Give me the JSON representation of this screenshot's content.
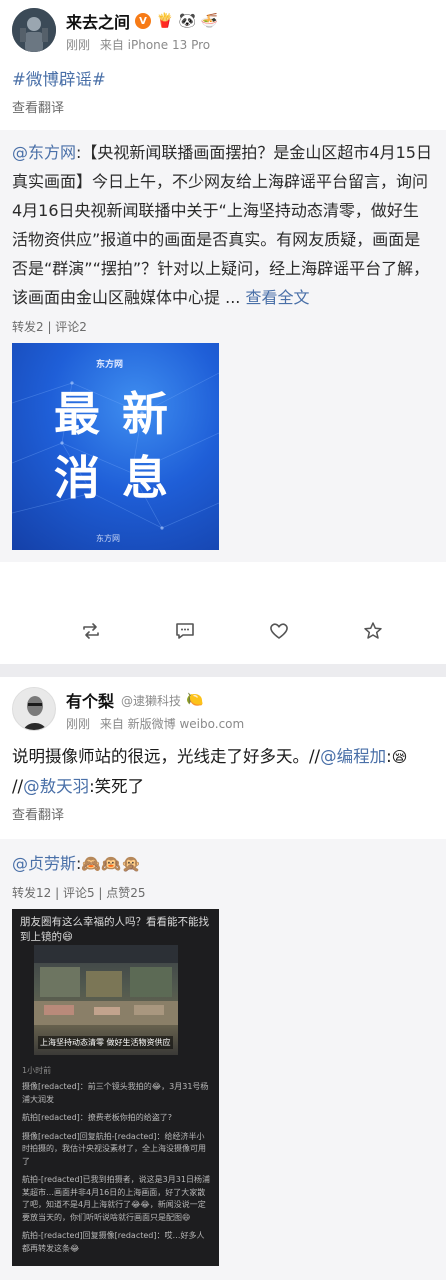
{
  "post1": {
    "author": {
      "name": "来去之间",
      "badges": [
        "verified-orange",
        "🍟",
        "🐼",
        "🍜"
      ]
    },
    "time": "刚刚",
    "source": "来自 iPhone 13 Pro",
    "topic": "#微博辟谣#",
    "translate": "查看翻译",
    "repost": {
      "mention": "@东方网",
      "colon": ":",
      "body": "【央视新闻联播画面摆拍？是金山区超市4月15日真实画面】今日上午，不少网友给上海辟谣平台留言，询问4月16日央视新闻联播中关于“上海坚持动态清零，做好生活物资供应”报道中的画面是否真实。有网友质疑，画面是否是“群演”“摆拍”？针对以上疑问，经上海辟谣平台了解，该画面由金山区融媒体中心提",
      "ellipsis": " ... ",
      "more": "查看全文",
      "stats": "转发2 | 评论2",
      "image": {
        "logo": "东方网",
        "chars": [
          "最",
          "新",
          "消",
          "息"
        ],
        "foot": "东方网"
      }
    },
    "actions": [
      "repost-icon",
      "comment-icon",
      "like-icon",
      "favorite-icon"
    ]
  },
  "post2": {
    "author": {
      "name": "有个梨",
      "handle": "@逮獭科技",
      "badge": "🍋"
    },
    "time": "刚刚",
    "source": "来自 新版微博 weibo.com",
    "body_before": "说明摄像师站的很远，光线走了好多天。//",
    "mention1": "@编程加",
    "colon1": ":",
    "emoji1": "😪",
    "sep": "//",
    "mention2": "@敖天羽",
    "body_after": ":笑死了",
    "translate": "查看翻译",
    "repost": {
      "mention": "@贞劳斯",
      "colon": ":",
      "emojis": "🙈🙉🙊",
      "stats": "转发12 | 评论5 | 点赞25",
      "screenshot": {
        "title": "朋友圈有这么幸福的人吗？看看能不能找到上镜的😄",
        "caption": "上海坚持动态清零 做好生活物资供应",
        "time": "1小时前",
        "comments": [
          "摄像[redacted]：前三个镜头我拍的😂，3月31号杨浦大润发",
          "航拍[redacted]：撩费老板你拍的给盗了?",
          "摄像[redacted]回复航拍-[redacted]：给经济半小时拍摄的，我估计央视没素材了，全上海没摄像可用了",
          "航拍-[redacted]已我到拍摄者，说这是3月31日杨浦某超市…画面并非4月16日的上海画面，好了大家散了吧，知道不是4月上海就行了😂😂，新闻没说一定要放当天的，你们听听说啥就行画面只是配图😄",
          "航拍-[redacted]回复摄像[redacted]：哎…好多人都再转发这条😂"
        ]
      }
    }
  }
}
